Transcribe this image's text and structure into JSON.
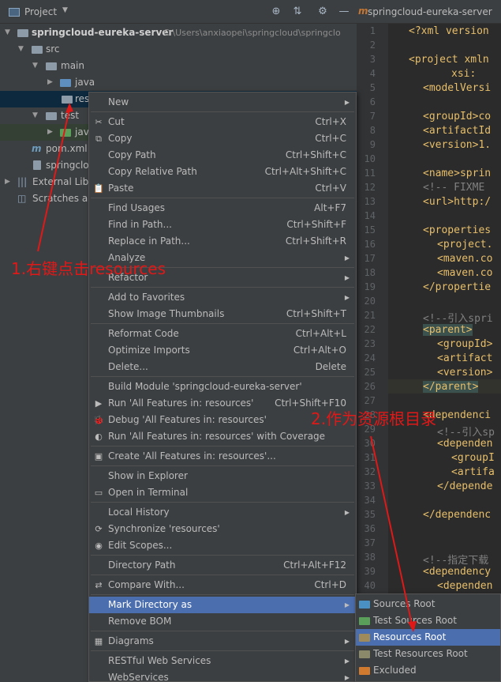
{
  "project_panel": {
    "title": "Project",
    "tree": [
      {
        "label": "springcloud-eureka-server",
        "path": "C:\\Users\\anxiaopei\\springcloud\\springclo"
      },
      {
        "label": "src"
      },
      {
        "label": "main"
      },
      {
        "label": "java"
      },
      {
        "label": "res"
      },
      {
        "label": "test"
      },
      {
        "label": "jav"
      },
      {
        "label": "pom.xml"
      },
      {
        "label": "springclo"
      },
      {
        "label": "External Libr"
      },
      {
        "label": "Scratches ar"
      }
    ]
  },
  "editor": {
    "tab": "springcloud-eureka-server",
    "line_numbers": [
      "1",
      "2",
      "3",
      "4",
      "5",
      "6",
      "7",
      "8",
      "9",
      "10",
      "11",
      "12",
      "13",
      "14",
      "15",
      "16",
      "17",
      "18",
      "19",
      "20",
      "21",
      "22",
      "23",
      "24",
      "25",
      "26",
      "27",
      "28",
      "29",
      "30",
      "31",
      "32",
      "33",
      "34",
      "35",
      "36",
      "37",
      "38",
      "39",
      "40"
    ],
    "lines": [
      {
        "n": 0,
        "t": "<?xml version"
      },
      {
        "n": 2,
        "t": "<project xmln"
      },
      {
        "n": 3,
        "t": "    xsi:"
      },
      {
        "n": 4,
        "t": "<modelVersi"
      },
      {
        "n": 6,
        "t": "<groupId>co"
      },
      {
        "n": 7,
        "t": "<artifactId"
      },
      {
        "n": 8,
        "t": "<version>1."
      },
      {
        "n": 10,
        "t": "<name>sprin"
      },
      {
        "n": 11,
        "t": "<!-- FIXME "
      },
      {
        "n": 12,
        "t": "<url>http:/"
      },
      {
        "n": 14,
        "t": "<properties"
      },
      {
        "n": 15,
        "t": "  <project."
      },
      {
        "n": 16,
        "t": "  <maven.co"
      },
      {
        "n": 17,
        "t": "  <maven.co"
      },
      {
        "n": 18,
        "t": "</propertie"
      },
      {
        "n": 20,
        "t": "<!--引入spri"
      },
      {
        "n": 21,
        "t": "<parent>"
      },
      {
        "n": 22,
        "t": "  <groupId>"
      },
      {
        "n": 23,
        "t": "  <artifact"
      },
      {
        "n": 24,
        "t": "  <version>"
      },
      {
        "n": 25,
        "t": "</parent>"
      },
      {
        "n": 27,
        "t": "<dependenci"
      },
      {
        "n": 28,
        "t": "  <!--引入sp"
      },
      {
        "n": 29,
        "t": "  <dependen"
      },
      {
        "n": 30,
        "t": "    <groupI"
      },
      {
        "n": 31,
        "t": "    <artifa"
      },
      {
        "n": 32,
        "t": "  </depende"
      },
      {
        "n": 34,
        "t": "</dependenc"
      },
      {
        "n": 37,
        "t": "<!--指定下载"
      },
      {
        "n": 38,
        "t": "<dependency"
      },
      {
        "n": 39,
        "t": "  <dependen"
      }
    ]
  },
  "context_menu": {
    "items": [
      {
        "label": "New",
        "shortcut": "",
        "sub": true,
        "icon": ""
      },
      {
        "sep": true
      },
      {
        "label": "Cut",
        "shortcut": "Ctrl+X",
        "icon": "✂"
      },
      {
        "label": "Copy",
        "shortcut": "Ctrl+C",
        "icon": "⧉"
      },
      {
        "label": "Copy Path",
        "shortcut": "Ctrl+Shift+C",
        "icon": ""
      },
      {
        "label": "Copy Relative Path",
        "shortcut": "Ctrl+Alt+Shift+C",
        "icon": ""
      },
      {
        "label": "Paste",
        "shortcut": "Ctrl+V",
        "icon": "📋"
      },
      {
        "sep": true
      },
      {
        "label": "Find Usages",
        "shortcut": "Alt+F7",
        "icon": ""
      },
      {
        "label": "Find in Path...",
        "shortcut": "Ctrl+Shift+F",
        "icon": ""
      },
      {
        "label": "Replace in Path...",
        "shortcut": "Ctrl+Shift+R",
        "icon": ""
      },
      {
        "label": "Analyze",
        "shortcut": "",
        "sub": true,
        "icon": ""
      },
      {
        "sep": true
      },
      {
        "label": "Refactor",
        "shortcut": "",
        "sub": true,
        "icon": ""
      },
      {
        "sep": true
      },
      {
        "label": "Add to Favorites",
        "shortcut": "",
        "sub": true,
        "icon": ""
      },
      {
        "label": "Show Image Thumbnails",
        "shortcut": "Ctrl+Shift+T",
        "icon": ""
      },
      {
        "sep": true
      },
      {
        "label": "Reformat Code",
        "shortcut": "Ctrl+Alt+L",
        "icon": ""
      },
      {
        "label": "Optimize Imports",
        "shortcut": "Ctrl+Alt+O",
        "icon": ""
      },
      {
        "label": "Delete...",
        "shortcut": "Delete",
        "icon": ""
      },
      {
        "sep": true
      },
      {
        "label": "Build Module 'springcloud-eureka-server'",
        "shortcut": "",
        "icon": ""
      },
      {
        "label": "Run 'All Features in: resources'",
        "shortcut": "Ctrl+Shift+F10",
        "icon": "▶"
      },
      {
        "label": "Debug 'All Features in: resources'",
        "shortcut": "",
        "icon": "🐞"
      },
      {
        "label": "Run 'All Features in: resources' with Coverage",
        "shortcut": "",
        "icon": "◐"
      },
      {
        "sep": true
      },
      {
        "label": "Create 'All Features in: resources'...",
        "shortcut": "",
        "icon": "▣"
      },
      {
        "sep": true
      },
      {
        "label": "Show in Explorer",
        "shortcut": "",
        "icon": ""
      },
      {
        "label": "Open in Terminal",
        "shortcut": "",
        "icon": "▭"
      },
      {
        "sep": true
      },
      {
        "label": "Local History",
        "shortcut": "",
        "sub": true,
        "icon": ""
      },
      {
        "label": "Synchronize 'resources'",
        "shortcut": "",
        "icon": "⟳"
      },
      {
        "label": "Edit Scopes...",
        "shortcut": "",
        "icon": "◉"
      },
      {
        "sep": true
      },
      {
        "label": "Directory Path",
        "shortcut": "Ctrl+Alt+F12",
        "icon": ""
      },
      {
        "sep": true
      },
      {
        "label": "Compare With...",
        "shortcut": "Ctrl+D",
        "icon": "⇄"
      },
      {
        "sep": true
      },
      {
        "label": "Mark Directory as",
        "shortcut": "",
        "sub": true,
        "icon": "",
        "selected": true
      },
      {
        "label": "Remove BOM",
        "shortcut": "",
        "icon": ""
      },
      {
        "sep": true
      },
      {
        "label": "Diagrams",
        "shortcut": "",
        "sub": true,
        "icon": "▦"
      },
      {
        "sep": true
      },
      {
        "label": "RESTful Web Services",
        "shortcut": "",
        "sub": true,
        "icon": ""
      },
      {
        "label": "WebServices",
        "shortcut": "",
        "sub": true,
        "icon": ""
      }
    ]
  },
  "submenu": {
    "items": [
      {
        "label": "Sources Root",
        "color": "#4a90c2"
      },
      {
        "label": "Test Sources Root",
        "color": "#5aa05a"
      },
      {
        "label": "Resources Root",
        "color": "#9e8a5a",
        "selected": true
      },
      {
        "label": "Test Resources Root",
        "color": "#8a8a6a"
      },
      {
        "label": "Excluded",
        "color": "#d07a30"
      }
    ]
  },
  "annotations": {
    "step1": "1.右键点击resources",
    "step2": "2.作为资源根目录"
  },
  "colors": {
    "menu_bg": "#3c3f41",
    "selection": "#4b6eaf",
    "annotation": "#e01818"
  }
}
